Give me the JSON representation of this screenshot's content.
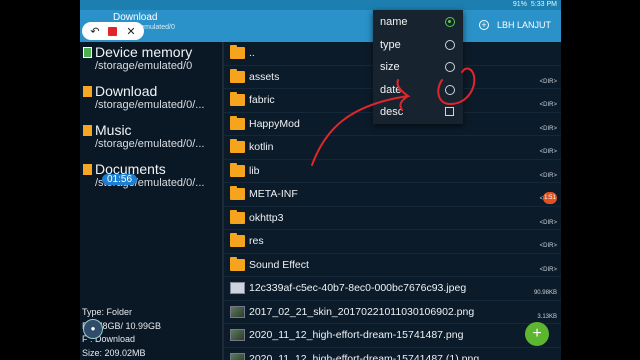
{
  "statusbar": {
    "battery": "91%",
    "time": "5:33 PM"
  },
  "header": {
    "title": "Download",
    "subtitle": "/storage/emulated/0",
    "action_label": "LBH LANJUT"
  },
  "places": [
    {
      "name": "Device memory",
      "path": "/storage/emulated/0",
      "icon": "device-icon"
    },
    {
      "name": "Download",
      "path": "/storage/emulated/0/...",
      "icon": "folder-icon"
    },
    {
      "name": "Music",
      "path": "/storage/emulated/0/...",
      "icon": "folder-icon"
    },
    {
      "name": "Documents",
      "path": "/storage/emulated/0/...",
      "icon": "folder-icon"
    }
  ],
  "recorder": {
    "timer": "01:56"
  },
  "info": {
    "type": "Type: Folder",
    "free": "F   2.78GB/ 10.99GB",
    "location": "F   : Download",
    "size": "Size: 209.02MB"
  },
  "files": [
    {
      "name": "..",
      "meta": "",
      "kind": "folder"
    },
    {
      "name": "assets",
      "meta": "<DIR>",
      "kind": "folder"
    },
    {
      "name": "fabric",
      "meta": "<DIR>",
      "kind": "folder"
    },
    {
      "name": "HappyMod",
      "meta": "<DIR>",
      "kind": "folder"
    },
    {
      "name": "kotlin",
      "meta": "<DIR>",
      "kind": "folder"
    },
    {
      "name": "lib",
      "meta": "<DIR>",
      "kind": "folder"
    },
    {
      "name": "META-INF",
      "meta": "<DIR>",
      "kind": "folder"
    },
    {
      "name": "okhttp3",
      "meta": "<DIR>",
      "kind": "folder"
    },
    {
      "name": "res",
      "meta": "<DIR>",
      "kind": "folder"
    },
    {
      "name": "Sound Effect",
      "meta": "<DIR>",
      "kind": "folder"
    },
    {
      "name": "12c339af-c5ec-40b7-8ec0-000bc7676c93.jpeg",
      "meta": "90.98KB",
      "kind": "image"
    },
    {
      "name": "2017_02_21_skin_20170221011030106902.png",
      "meta": "3.13KB",
      "kind": "thumb"
    },
    {
      "name": "2020_11_12_high-effort-dream-15741487.png",
      "meta": "",
      "kind": "thumb"
    },
    {
      "name": "2020_11_12_high-effort-dream-15741487 (1).png",
      "meta": "",
      "kind": "thumb"
    }
  ],
  "sort_menu": {
    "options": [
      {
        "label": "name",
        "control": "radio",
        "selected": true
      },
      {
        "label": "type",
        "control": "radio",
        "selected": false
      },
      {
        "label": "size",
        "control": "radio",
        "selected": false
      },
      {
        "label": "date",
        "control": "radio",
        "selected": false
      },
      {
        "label": "desc",
        "control": "checkbox",
        "selected": false
      }
    ]
  },
  "badge": "1:51",
  "fab_label": "+",
  "colors": {
    "header": "#2a92c8",
    "folder": "#f6a31e",
    "accent_green": "#5cb630",
    "annotation": "#e0262c"
  }
}
